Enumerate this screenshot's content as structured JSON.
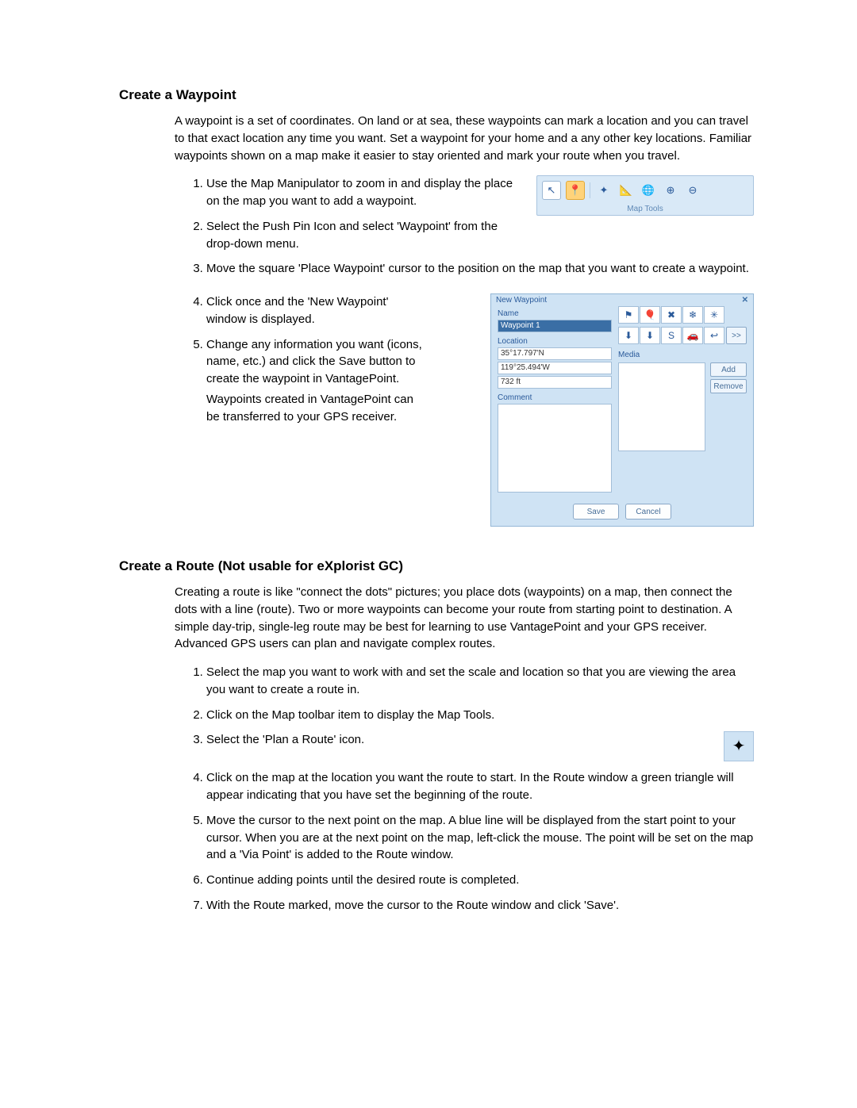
{
  "sections": {
    "waypoint": {
      "heading": "Create a Waypoint",
      "intro": "A waypoint is a set of coordinates. On land or at sea, these waypoints can mark a location and you can travel to that exact location any time you want. Set a waypoint for your home and a any other key locations. Familiar waypoints shown on a map make it easier to stay oriented and mark your route when you travel.",
      "steps": [
        "Use the Map Manipulator to zoom in and display the place on the map you want to add a waypoint.",
        "Select the Push Pin Icon and select 'Waypoint' from the drop-down menu.",
        "Move the square 'Place Waypoint' cursor to the position on the map that you want to create a waypoint.",
        "Click once and the 'New Waypoint' window is displayed.",
        "Change any information you want (icons, name, etc.) and click the Save button to create the waypoint in VantagePoint."
      ],
      "note": "Waypoints created in VantagePoint can be transferred to your GPS receiver."
    },
    "route": {
      "heading": "Create a Route (Not usable for eXplorist GC)",
      "intro": "Creating a route is like \"connect the dots\" pictures; you place dots (waypoints) on a map, then connect the dots with a line (route). Two or more waypoints can become your route from starting point to destination. A simple day-trip, single-leg route may be best for learning to use VantagePoint and your GPS receiver. Advanced GPS users can plan and navigate complex routes.",
      "steps": [
        "Select the map you want to work with and set the scale and location so that you are viewing the area you want to create a route in.",
        "Click on the Map toolbar item to display the Map Tools.",
        "Select the 'Plan a Route' icon.",
        "Click on the map at the location you want the route to start.  In the Route window a green triangle will appear indicating that you have set the beginning of the route.",
        "Move the cursor to the next point on the map.  A blue line will be displayed from the start point to your cursor.  When you are at the next point on the map, left-click the mouse.  The point will be set on the map and a 'Via Point' is added to the Route window.",
        "Continue adding points until the desired route is completed.",
        "With the Route marked, move the cursor to the Route window and click 'Save'."
      ]
    }
  },
  "map_tools": {
    "label": "Map Tools"
  },
  "dialog": {
    "title": "New Waypoint",
    "labels": {
      "name": "Name",
      "location": "Location",
      "comment": "Comment",
      "media": "Media"
    },
    "name_value": "Waypoint 1",
    "lat": "35°17.797'N",
    "lon": "119°25.494'W",
    "elev": "732 ft",
    "buttons": {
      "add": "Add",
      "remove": "Remove",
      "save": "Save",
      "cancel": "Cancel",
      "more": ">>"
    }
  }
}
